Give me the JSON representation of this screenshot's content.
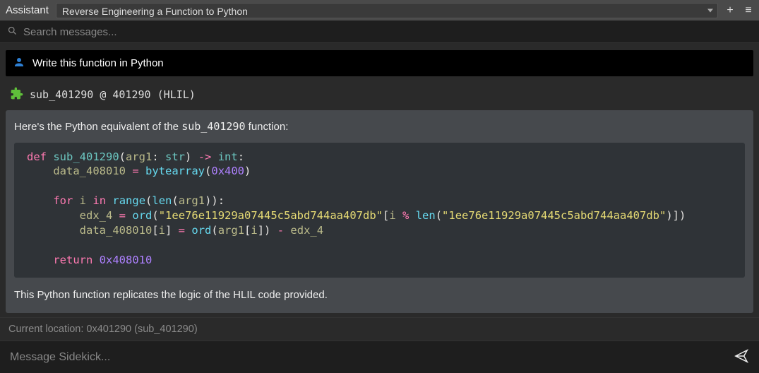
{
  "header": {
    "title": "Assistant",
    "dropdown_selected": "Reverse Engineering a Function to Python"
  },
  "search": {
    "placeholder": "Search messages..."
  },
  "conversation": {
    "user_message": "Write this function in Python",
    "context": {
      "symbol": "sub_401290",
      "at": "@",
      "address": "401290",
      "il_label": "(HLIL)"
    },
    "assistant_intro_prefix": "Here's the Python equivalent of the ",
    "assistant_intro_symbol": "sub_401290",
    "assistant_intro_suffix": " function:",
    "assistant_outro": "This Python function replicates the logic of the HLIL code provided.",
    "code": {
      "fn_name": "sub_401290",
      "arg_name": "arg1",
      "arg_type": "str",
      "ret_type": "int",
      "buf_name": "data_408010",
      "buf_size_hex": "0x400",
      "loop_var": "i",
      "key_string": "\"1ee76e11929a07445c5abd744aa407db\"",
      "tmp_name": "edx_4",
      "return_hex": "0x408010"
    }
  },
  "status": {
    "prefix": "Current location: ",
    "address": "0x401290",
    "symbol": "sub_401290"
  },
  "input": {
    "placeholder": "Message Sidekick..."
  },
  "icons": {
    "search": "search-icon",
    "user": "user-icon",
    "puzzle": "puzzle-icon",
    "plus": "plus-icon",
    "menu": "menu-icon",
    "send": "send-icon",
    "chevron_down": "chevron-down-icon"
  }
}
